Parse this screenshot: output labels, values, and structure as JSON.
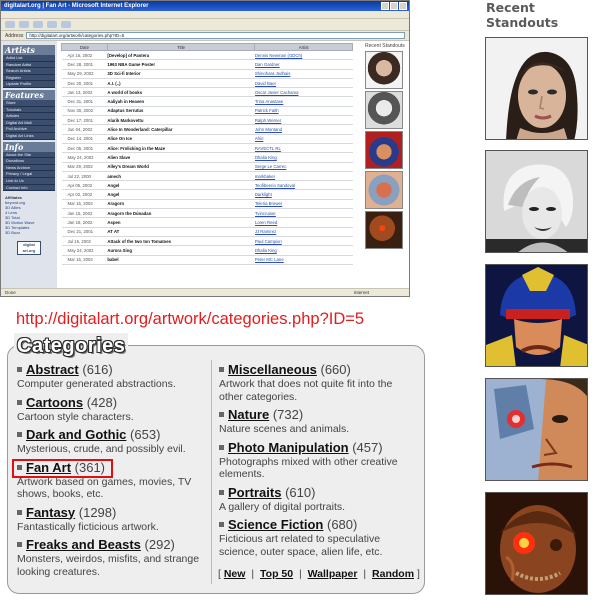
{
  "browser": {
    "title": "digitalart.org | Fan Art - Microsoft Internet Explorer",
    "address_label": "Address",
    "url": "http://digitalart.org/artwork/categories.php?ID=5",
    "status": "Done",
    "zone": "Internet"
  },
  "site": {
    "sidebar": [
      {
        "head": "Artists",
        "items": [
          "Artist List",
          "Random Artist",
          "Search Artists",
          "Register",
          "Update Profile"
        ]
      },
      {
        "head": "Features",
        "items": [
          "Store",
          "Tutorials",
          "Articles",
          "Digital Art Mall",
          "Poll Archive",
          "Digital Art Links"
        ]
      },
      {
        "head": "Info",
        "items": [
          "About the Site",
          "Donations",
          "News Archive",
          "Privacy / Legal",
          "Link to Us",
          "Contact Info"
        ]
      }
    ],
    "affiliates_label": "Affiliates",
    "affiliates": [
      "beyond.org",
      "3D Allies",
      "4 Lens",
      "3D Total",
      "3D Motion Wave",
      "3D Templates",
      "3D Buzz"
    ],
    "logo": "digital art.org",
    "table_headers": [
      "Date",
      "Title",
      "Artist"
    ],
    "table_rows": [
      {
        "date": "Apr 16, 2002",
        "title": "[Develop] of Pantera",
        "artist": "Dennis Newman (GDCh)"
      },
      {
        "date": "Dec 28, 2001",
        "title": "1963 NBA Game Poster",
        "artist": "Dan Gardner"
      },
      {
        "date": "May 29, 2002",
        "title": "3D Sci-fi Interior",
        "artist": "Shinohara Jedhais"
      },
      {
        "date": "Dec 20, 2001",
        "title": "A.I. (..)",
        "artist": "David Baer"
      },
      {
        "date": "Jan 13, 2002",
        "title": "A world of books",
        "artist": "Oscar Javier Cachama"
      },
      {
        "date": "Dec 31, 2001",
        "title": "Aaliyah in Heaven",
        "artist": "Trina Anastase"
      },
      {
        "date": "Nov 30, 2002",
        "title": "Adaptus Serrutus",
        "artist": "Patrick Faith"
      },
      {
        "date": "Dec 17, 2001",
        "title": "Alarik Markovettu",
        "artist": "Ralph Werner"
      },
      {
        "date": "Jun 04, 2002",
        "title": "Alice In Wonderland: Caterpillar",
        "artist": "John Montand"
      },
      {
        "date": "Dec 14, 2001",
        "title": "Alice On Ice",
        "artist": "Ahiri"
      },
      {
        "date": "Dec 05, 2001",
        "title": "Alice: Frolicking in the Maze",
        "artist": "RAVECTL RL"
      },
      {
        "date": "May 24, 2002",
        "title": "Alien Slave",
        "artist": "Dhalia King"
      },
      {
        "date": "Mar 29, 2002",
        "title": "Alley's Dream World",
        "artist": "Serge Le Carrec"
      },
      {
        "date": "Jul 22, 2000",
        "title": "amech",
        "artist": "markbaker"
      },
      {
        "date": "Apr 05, 2002",
        "title": "Angel",
        "artist": "Teofibeerio Sandoval"
      },
      {
        "date": "Apr 02, 2002",
        "title": "Angel",
        "artist": "Darklight"
      },
      {
        "date": "Mar 15, 2002",
        "title": "Aragorn",
        "artist": "Teleria Brewer"
      },
      {
        "date": "Jan 15, 2002",
        "title": "Aragorn the Dúnadan",
        "artist": "Tvincruiser"
      },
      {
        "date": "Jan 18, 2002",
        "title": "Aspen",
        "artist": "Loren Reed"
      },
      {
        "date": "Dec 21, 2001",
        "title": "AT AT",
        "artist": "JJ Ramirez"
      },
      {
        "date": "Jul 15, 2002",
        "title": "Attack of the two ton Tomatoes",
        "artist": "Paul Campion"
      },
      {
        "date": "May 24, 2002",
        "title": "Aurora Sing",
        "artist": "Dhalia King"
      },
      {
        "date": "Mar 15, 2002",
        "title": "babel",
        "artist": "Peter MC Lane"
      }
    ],
    "standouts_label": "Recent Standouts"
  },
  "caption_url": "http://digitalart.org/artwork/categories.php?ID=5",
  "categories": {
    "title": "Categories",
    "left": [
      {
        "name": "Abstract",
        "count": "(616)",
        "desc": "Computer generated abstractions."
      },
      {
        "name": "Cartoons",
        "count": "(428)",
        "desc": "Cartoon style characters."
      },
      {
        "name": "Dark and Gothic",
        "count": "(653)",
        "desc": "Mysterious, crude, and possibly evil."
      },
      {
        "name": "Fan Art",
        "count": "(361)",
        "desc": "Artwork based on games, movies, TV shows, books, etc."
      },
      {
        "name": "Fantasy",
        "count": "(1298)",
        "desc": "Fantastically ficticious artwork."
      },
      {
        "name": "Freaks and Beasts",
        "count": "(292)",
        "desc": "Monsters, weirdos, misfits, and strange looking creatures."
      }
    ],
    "right": [
      {
        "name": "Miscellaneous",
        "count": "(660)",
        "desc": "Artwork that does not quite fit into the other categories."
      },
      {
        "name": "Nature",
        "count": "(732)",
        "desc": "Nature scenes and animals."
      },
      {
        "name": "Photo Manipulation",
        "count": "(457)",
        "desc": "Photographs mixed with other creative elements."
      },
      {
        "name": "Portraits",
        "count": "(610)",
        "desc": "A gallery of digital portraits."
      },
      {
        "name": "Science Fiction",
        "count": "(680)",
        "desc": "Ficticious art related to speculative science, outer space, alien life, etc."
      }
    ],
    "links": [
      "New",
      "Top 50",
      "Wallpaper",
      "Random"
    ],
    "bracket_open": "[",
    "bracket_close": "]",
    "separator": "|"
  },
  "standouts": {
    "title": "Recent Standouts",
    "thumbs": [
      "portrait-woman-thumb",
      "portrait-marilyn-thumb",
      "helmeted-warrior-thumb",
      "cyborg-face-thumb",
      "mutant-creature-thumb"
    ]
  }
}
